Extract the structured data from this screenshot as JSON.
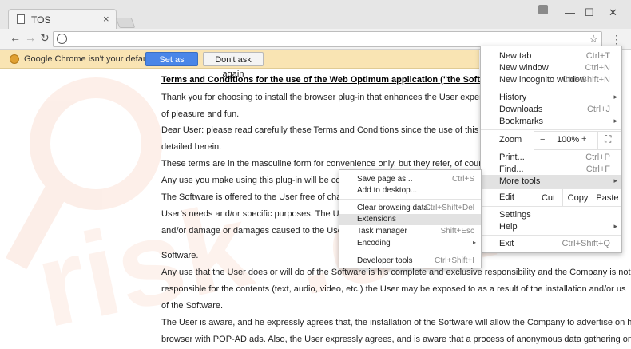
{
  "browser": {
    "tab": {
      "title": "TOS",
      "close": "×"
    },
    "window_controls": {
      "minimize": "—",
      "maximize": "☐",
      "close": "✕"
    },
    "toolbar": {
      "back": "←",
      "forward": "→",
      "reload": "↻",
      "info": "i",
      "star": "☆",
      "menu": "⋮"
    }
  },
  "infobar": {
    "message": "Google Chrome isn't your default browser.",
    "set_default": "Set as default",
    "dont_ask": "Don't ask again"
  },
  "page": {
    "heading": "Terms and Conditions for the use of the Web Optimum application (\"the Software\") from bsc",
    "lines": [
      "Thank you for choosing to install the browser plug-in that enhances the User experience on browse",
      "of pleasure and fun.",
      "Dear User: please read carefully these Terms and Conditions since the use of this Software is subje",
      "detailed herein.",
      "These terms are in the masculine form for convenience only, but they refer, of course, to females as",
      "Any use you make using this plug-in will be considered",
      "The Software is offered to the User free of charge and A",
      "User’s needs and/or specific purposes. The User hereb",
      "and/or damage or damages caused to the User and/or",
      "Software.",
      "Any use that the User does or will do of the Software is his complete and exclusive responsibility and the Company is not",
      "responsible for the contents (text, audio, video, etc.) the User may be exposed to as a result of the installation and/or us",
      "of the Software.",
      "The User is aware, and he expressly agrees that, the installation of the Software will allow the Company to advertise on his",
      "browser with POP-AD ads. Also, the User expressly agrees, and is aware that a process of anonymous data gathering on"
    ]
  },
  "main_menu": {
    "new_tab": {
      "label": "New tab",
      "shortcut": "Ctrl+T"
    },
    "new_window": {
      "label": "New window",
      "shortcut": "Ctrl+N"
    },
    "incognito": {
      "label": "New incognito window",
      "shortcut": "Ctrl+Shift+N"
    },
    "history": {
      "label": "History"
    },
    "downloads": {
      "label": "Downloads",
      "shortcut": "Ctrl+J"
    },
    "bookmarks": {
      "label": "Bookmarks"
    },
    "zoom": {
      "label": "Zoom",
      "minus": "−",
      "value": "100%",
      "plus": "+",
      "fullscreen": "⛶"
    },
    "print": {
      "label": "Print...",
      "shortcut": "Ctrl+P"
    },
    "find": {
      "label": "Find...",
      "shortcut": "Ctrl+F"
    },
    "more_tools": {
      "label": "More tools"
    },
    "edit": {
      "label": "Edit",
      "cut": "Cut",
      "copy": "Copy",
      "paste": "Paste"
    },
    "settings": {
      "label": "Settings"
    },
    "help": {
      "label": "Help"
    },
    "exit": {
      "label": "Exit",
      "shortcut": "Ctrl+Shift+Q"
    },
    "arrow": "▸"
  },
  "sub_menu": {
    "save_page": {
      "label": "Save page as...",
      "shortcut": "Ctrl+S"
    },
    "add_desktop": {
      "label": "Add to desktop..."
    },
    "clear_data": {
      "label": "Clear browsing data...",
      "shortcut": "Ctrl+Shift+Del"
    },
    "extensions": {
      "label": "Extensions"
    },
    "task_manager": {
      "label": "Task manager",
      "shortcut": "Shift+Esc"
    },
    "encoding": {
      "label": "Encoding"
    },
    "dev_tools": {
      "label": "Developer tools",
      "shortcut": "Ctrl+Shift+I"
    }
  },
  "colors": {
    "infobar_bg": "#f9e4b3",
    "primary_button": "#4a86e8",
    "highlight": "#e2e2e2",
    "watermark": "#e8642c"
  }
}
